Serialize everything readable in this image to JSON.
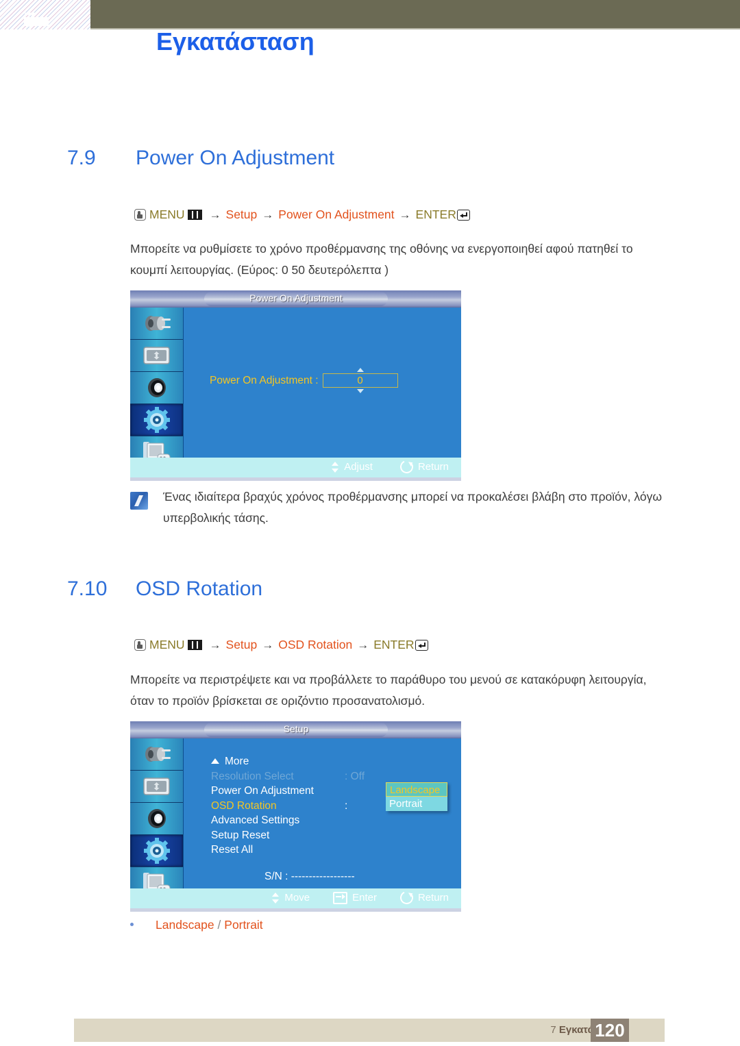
{
  "header": {
    "chapter_number": "7",
    "title": "Εγκατάσταση"
  },
  "sections": [
    {
      "number": "7.9",
      "title": "Power On Adjustment",
      "breadcrumb": {
        "menu_label": "MENU",
        "arrow": "→",
        "step1": "Setup",
        "step2": "Power On Adjustment",
        "enter_label": "ENTER"
      },
      "paragraph": "Μπορείτε να ρυθμίσετε το χρόνο προθέρμανσης της οθόνης να ενεργοποιηθεί αφού πατηθεί το κουμπί λειτουργίας. (Εύρος: 0   50 δευτερόλεπτα )",
      "note": "Ένας ιδιαίτερα βραχύς χρόνος προθέρμανσης μπορεί να προκαλέσει βλάβη στο προϊόν, λόγω υπερβολικής τάσης."
    },
    {
      "number": "7.10",
      "title": "OSD Rotation",
      "breadcrumb": {
        "menu_label": "MENU",
        "arrow": "→",
        "step1": "Setup",
        "step2": "OSD Rotation",
        "enter_label": "ENTER"
      },
      "paragraph": "Μπορείτε να περιστρέψετε και να προβάλλετε το παράθυρο του μενού σε κατακόρυφη λειτουργία, όταν το προϊόν βρίσκεται σε οριζόντιο προσανατολισμό.",
      "bullet": {
        "option_a": "Landscape",
        "separator": "/",
        "option_b": "Portrait"
      }
    }
  ],
  "osd1": {
    "title": "Power On Adjustment",
    "field_label": "Power On Adjustment :",
    "field_value": "0",
    "footer": [
      {
        "icon": "up-down-arrows-icon",
        "label": "Adjust"
      },
      {
        "icon": "return-icon",
        "label": "Return"
      }
    ],
    "rail_icons": [
      "input-source-icon",
      "picture-icon",
      "sound-icon",
      "setup-gear-icon",
      "multi-control-icon"
    ],
    "active_rail_index": 3
  },
  "osd2": {
    "title": "Setup",
    "more_label": "More",
    "items": [
      {
        "label": "Resolution Select",
        "value": ": Off",
        "state": "dim"
      },
      {
        "label": "Power On Adjustment",
        "value": "",
        "state": "normal"
      },
      {
        "label": "OSD Rotation",
        "value": ":",
        "state": "selected"
      },
      {
        "label": "Advanced Settings",
        "value": "",
        "state": "normal"
      },
      {
        "label": "Setup Reset",
        "value": "",
        "state": "normal"
      },
      {
        "label": "Reset All",
        "value": "",
        "state": "normal"
      }
    ],
    "dropdown": {
      "selected": "Landscape",
      "other": "Portrait"
    },
    "serial_number": "S/N : ------------------",
    "footer": [
      {
        "icon": "up-down-arrows-icon",
        "label": "Move"
      },
      {
        "icon": "enter-icon",
        "label": "Enter"
      },
      {
        "icon": "return-icon",
        "label": "Return"
      }
    ],
    "rail_icons": [
      "input-source-icon",
      "picture-icon",
      "sound-icon",
      "setup-gear-icon",
      "multi-control-icon"
    ],
    "active_rail_index": 3
  },
  "footer": {
    "chapter_num": "7",
    "chapter_name": "Εγκατάσταση",
    "page_number": "120"
  },
  "colors": {
    "heading_blue": "#2e6fd9",
    "accent_orange": "#e2521d",
    "menu_gold": "#8a7b2a",
    "osd_blue": "#2e82cc",
    "osd_yellow": "#f4c623",
    "header_olive": "#6b6a54",
    "footer_tan": "#ddd7c4"
  }
}
